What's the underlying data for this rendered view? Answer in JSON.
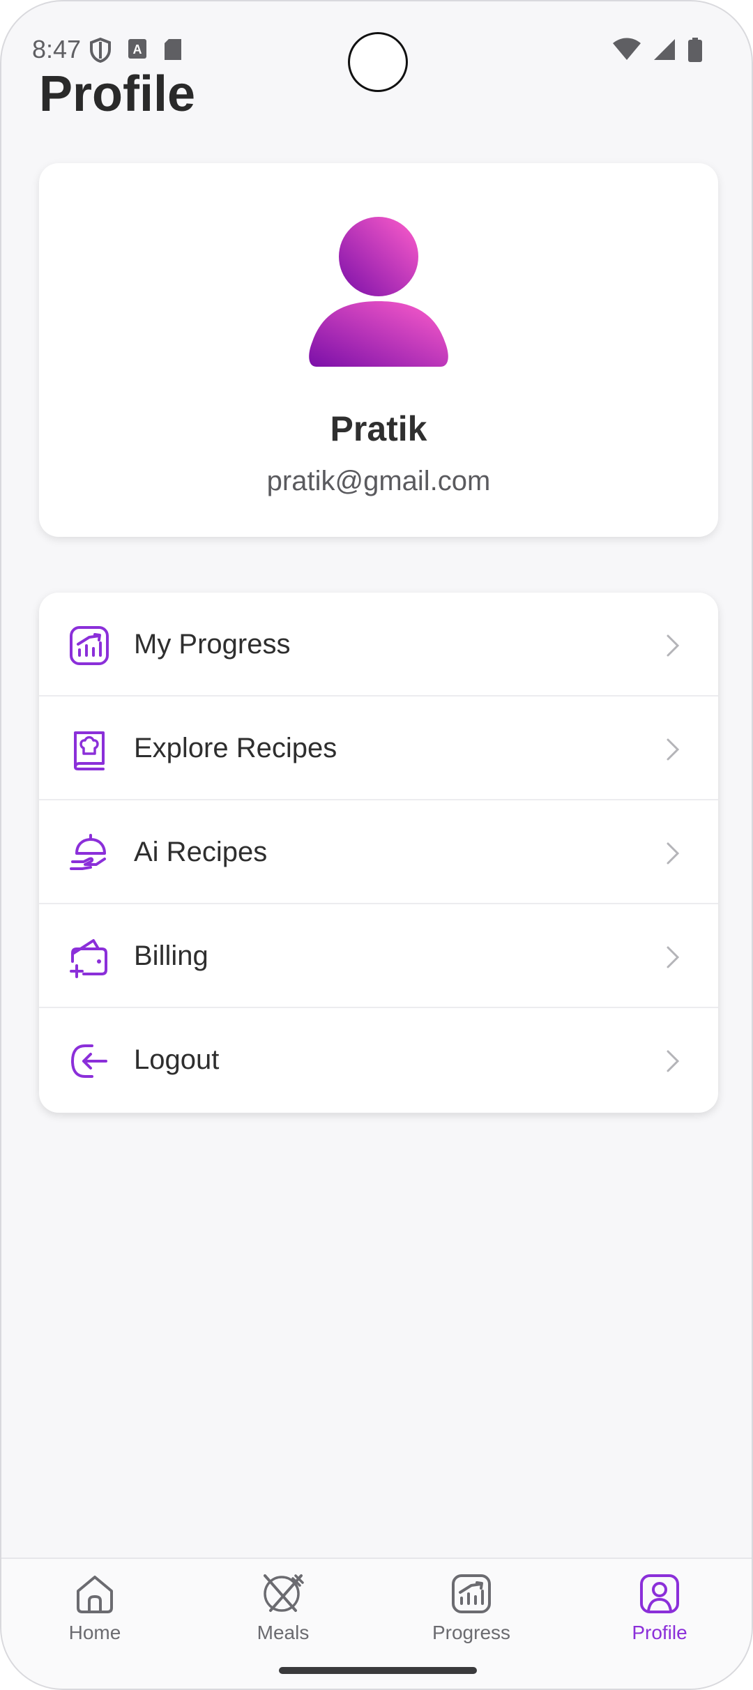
{
  "status_bar": {
    "time": "8:47",
    "left_icons": [
      "shield-icon",
      "font-a-icon",
      "sd-card-icon"
    ],
    "right_icons": [
      "wifi-icon",
      "cell-signal-icon",
      "battery-icon"
    ]
  },
  "header": {
    "title": "Profile"
  },
  "profile": {
    "name": "Pratik",
    "email": "pratik@gmail.com",
    "avatar_gradient": [
      "#ff5fcb",
      "#7a0fa8"
    ]
  },
  "menu": {
    "items": [
      {
        "label": "My Progress",
        "icon": "chart-up-icon"
      },
      {
        "label": "Explore Recipes",
        "icon": "recipe-book-icon"
      },
      {
        "label": "Ai Recipes",
        "icon": "serving-cloche-icon"
      },
      {
        "label": "Billing",
        "icon": "wallet-add-icon"
      },
      {
        "label": "Logout",
        "icon": "logout-icon"
      }
    ]
  },
  "bottom_nav": {
    "items": [
      {
        "label": "Home",
        "icon": "home-icon",
        "active": false
      },
      {
        "label": "Meals",
        "icon": "fork-spoon-icon",
        "active": false
      },
      {
        "label": "Progress",
        "icon": "chart-up-icon",
        "active": false
      },
      {
        "label": "Profile",
        "icon": "profile-icon",
        "active": true
      }
    ]
  },
  "colors": {
    "accent": "#8b2fd9",
    "background": "#f7f7f9",
    "text": "#2e2e2e"
  }
}
